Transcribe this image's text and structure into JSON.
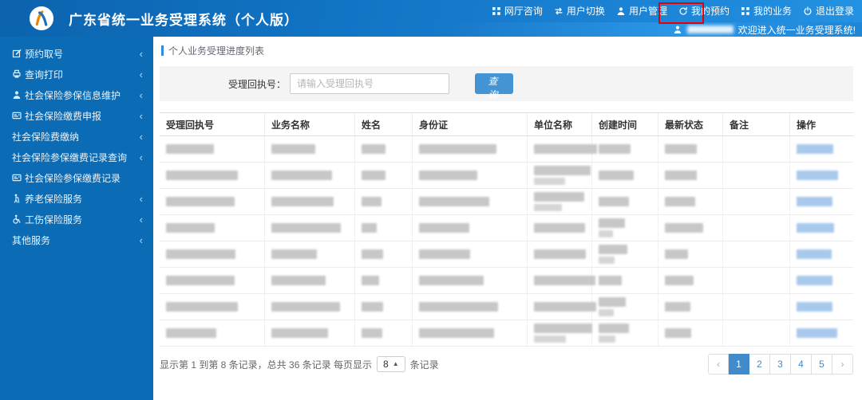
{
  "header": {
    "title": "广东省统一业务受理系统（个人版）",
    "nav": [
      {
        "label": "网厅咨询",
        "icon": "grid-icon"
      },
      {
        "label": "用户切换",
        "icon": "switch-user-icon",
        "annotated": true
      },
      {
        "label": "用户管理",
        "icon": "user-icon"
      },
      {
        "label": "我的预约",
        "icon": "history-icon"
      },
      {
        "label": "我的业务",
        "icon": "grid-icon"
      },
      {
        "label": "退出登录",
        "icon": "power-icon"
      }
    ],
    "welcome_text": "欢迎进入统一业务受理系统!"
  },
  "sidebar": {
    "items": [
      {
        "label": "预约取号",
        "icon": "edit-icon",
        "expandable": true
      },
      {
        "label": "查询打印",
        "icon": "printer-icon",
        "expandable": true
      },
      {
        "label": "社会保险参保信息维护",
        "icon": "user-icon",
        "expandable": true
      },
      {
        "label": "社会保险缴费申报",
        "icon": "id-card-icon",
        "expandable": true
      },
      {
        "label": "社会保险费缴纳",
        "icon": null,
        "expandable": true
      },
      {
        "label": "社会保险参保缴费记录查询",
        "icon": null,
        "expandable": true
      },
      {
        "label": "社会保险参保缴费记录",
        "icon": "id-card-icon",
        "expandable": false
      },
      {
        "label": "养老保险服务",
        "icon": "elder-icon",
        "expandable": true
      },
      {
        "label": "工伤保险服务",
        "icon": "wheelchair-icon",
        "expandable": true
      },
      {
        "label": "其他服务",
        "icon": null,
        "expandable": true
      }
    ]
  },
  "main": {
    "section_title": "个人业务受理进度列表",
    "search": {
      "label": "受理回执号：",
      "placeholder": "请输入受理回执号",
      "button": "查 询"
    },
    "table": {
      "headers": [
        "受理回执号",
        "业务名称",
        "姓名",
        "身份证",
        "单位名称",
        "创建时间",
        "最新状态",
        "备注",
        "操作"
      ],
      "row_count": 8,
      "rows_redacted": true
    },
    "pagination": {
      "info_prefix": "显示第 1 到第 8 条记录，总共 36 条记录 每页显示",
      "page_size": "8",
      "info_suffix": "条记录",
      "pages": [
        "1",
        "2",
        "3",
        "4",
        "5"
      ],
      "active_page": "1",
      "prev": "‹",
      "next": "›"
    }
  },
  "colors": {
    "header_blue": "#1173c4",
    "sidebar_blue": "#0b6cb5",
    "accent_blue": "#4493d3",
    "pagination_active": "#428bca",
    "annotation_red": "#e60000"
  }
}
